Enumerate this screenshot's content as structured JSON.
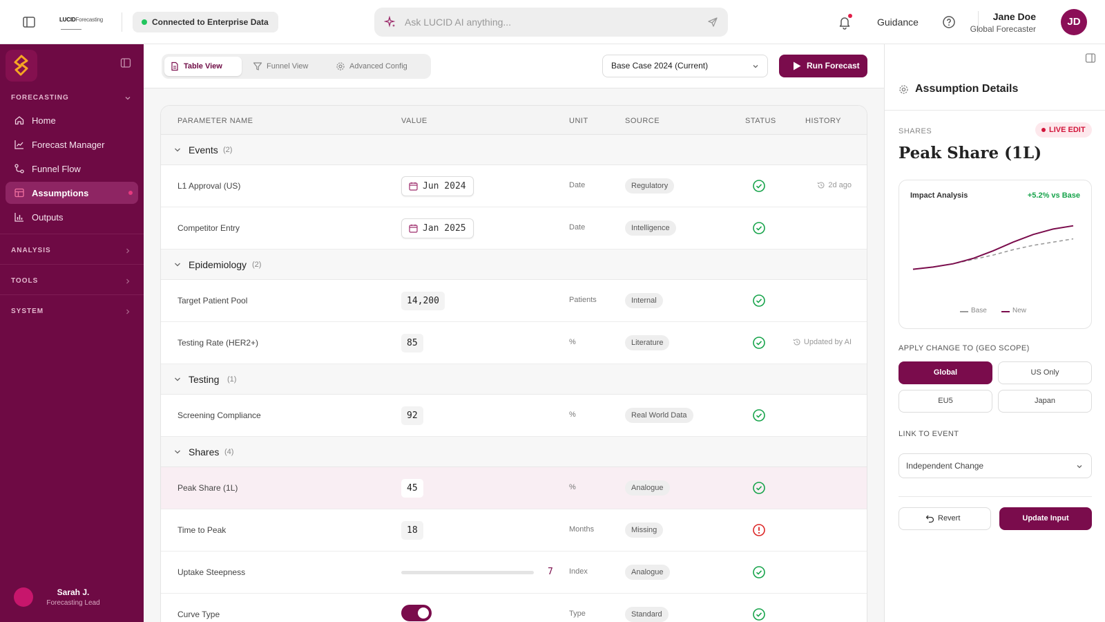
{
  "colors": {
    "brand": "#6e0a44",
    "accent": "#7a0c4c",
    "success": "#16a34a",
    "error": "#dc2626",
    "live": "#d1153a"
  },
  "topbar": {
    "brand_bold": "LUCID",
    "brand_light": "Forecasting",
    "connection_status": "Connected to Enterprise Data",
    "search_placeholder": "Ask LUCID AI anything...",
    "guidance": "Guidance",
    "user_name": "Jane Doe",
    "user_role": "Global Forecaster",
    "user_initials": "JD",
    "icons": [
      "sidebar-toggle-icon",
      "sparkle-icon",
      "send-icon",
      "bell-icon",
      "help-icon"
    ]
  },
  "sidebar": {
    "sections": {
      "forecasting": "FORECASTING",
      "analysis": "ANALYSIS",
      "tools": "TOOLS",
      "system": "SYSTEM"
    },
    "items": [
      {
        "label": "Home",
        "icon": "home-icon"
      },
      {
        "label": "Forecast Manager",
        "icon": "line-chart-icon"
      },
      {
        "label": "Funnel Flow",
        "icon": "flow-icon"
      },
      {
        "label": "Assumptions",
        "icon": "table-icon",
        "active": true
      },
      {
        "label": "Outputs",
        "icon": "bar-chart-icon"
      }
    ],
    "user": {
      "name": "Sarah J.",
      "role": "Forecasting Lead"
    }
  },
  "toolbar": {
    "tabs": [
      {
        "label": "Table View",
        "icon": "document-icon",
        "active": true
      },
      {
        "label": "Funnel View",
        "icon": "funnel-icon"
      },
      {
        "label": "Advanced Config",
        "icon": "gear-icon"
      }
    ],
    "scenario": "Base Case 2024 (Current)",
    "run_label": "Run Forecast"
  },
  "table": {
    "headers": [
      "PARAMETER NAME",
      "VALUE",
      "UNIT",
      "SOURCE",
      "STATUS",
      "HISTORY"
    ],
    "groups": [
      {
        "name": "Events",
        "count": "(2)"
      },
      {
        "name": "Epidemiology",
        "count": "(2)"
      },
      {
        "name": "Testing",
        "count": "(1)"
      },
      {
        "name": "Shares",
        "count": "(4)"
      }
    ],
    "rows": [
      {
        "name": "L1 Approval (US)",
        "value": "Jun 2024",
        "unit": "Date",
        "source": "Regulatory",
        "status": "ok",
        "history": "2d ago"
      },
      {
        "name": "Competitor Entry",
        "value": "Jan 2025",
        "unit": "Date",
        "source": "Intelligence",
        "status": "ok",
        "history": ""
      },
      {
        "name": "Target Patient Pool",
        "value": "14,200",
        "unit": "Patients",
        "source": "Internal",
        "status": "ok",
        "history": ""
      },
      {
        "name": "Testing Rate (HER2+)",
        "value": "85",
        "unit": "%",
        "source": "Literature",
        "status": "ok",
        "history": "Updated by AI"
      },
      {
        "name": "Screening Compliance",
        "value": "92",
        "unit": "%",
        "source": "Real World Data",
        "status": "ok",
        "history": ""
      },
      {
        "name": "Peak Share (1L)",
        "value": "45",
        "unit": "%",
        "source": "Analogue",
        "status": "ok",
        "history": ""
      },
      {
        "name": "Time to Peak",
        "value": "18",
        "unit": "Months",
        "source": "Missing",
        "status": "error",
        "history": ""
      },
      {
        "name": "Uptake Steepness",
        "value": "7",
        "unit": "Index",
        "source": "Analogue",
        "status": "ok",
        "history": ""
      },
      {
        "name": "Curve Type",
        "value": "on",
        "unit": "Type",
        "source": "Standard",
        "status": "ok",
        "history": ""
      }
    ]
  },
  "panel": {
    "title": "Assumption Details",
    "category": "SHARES",
    "live_badge": "LIVE EDIT",
    "param_name": "Peak Share (1L)",
    "impact_title": "Impact Analysis",
    "impact_delta": "+5.2% vs Base",
    "legend_base": "Base",
    "legend_new": "New",
    "geo_label": "APPLY CHANGE TO (GEO SCOPE)",
    "geo_options": [
      "Global",
      "US Only",
      "EU5",
      "Japan"
    ],
    "geo_selected": "Global",
    "link_label": "LINK TO EVENT",
    "link_value": "Independent Change",
    "revert_label": "Revert",
    "update_label": "Update Input"
  },
  "chart_data": {
    "type": "line",
    "title": "Impact Analysis",
    "x": [
      0,
      1,
      2,
      3,
      4,
      5,
      6,
      7,
      8
    ],
    "series": [
      {
        "name": "Base",
        "values": [
          20,
          22,
          25,
          29,
          33,
          38,
          42,
          45,
          48
        ],
        "style": "dashed",
        "color": "#9a9a9a"
      },
      {
        "name": "New",
        "values": [
          20,
          22,
          25,
          30,
          37,
          45,
          52,
          57,
          60
        ],
        "style": "solid",
        "color": "#7a0c4c"
      }
    ],
    "ylim": [
      0,
      70
    ],
    "legend": "bottom-center",
    "grid": false
  }
}
